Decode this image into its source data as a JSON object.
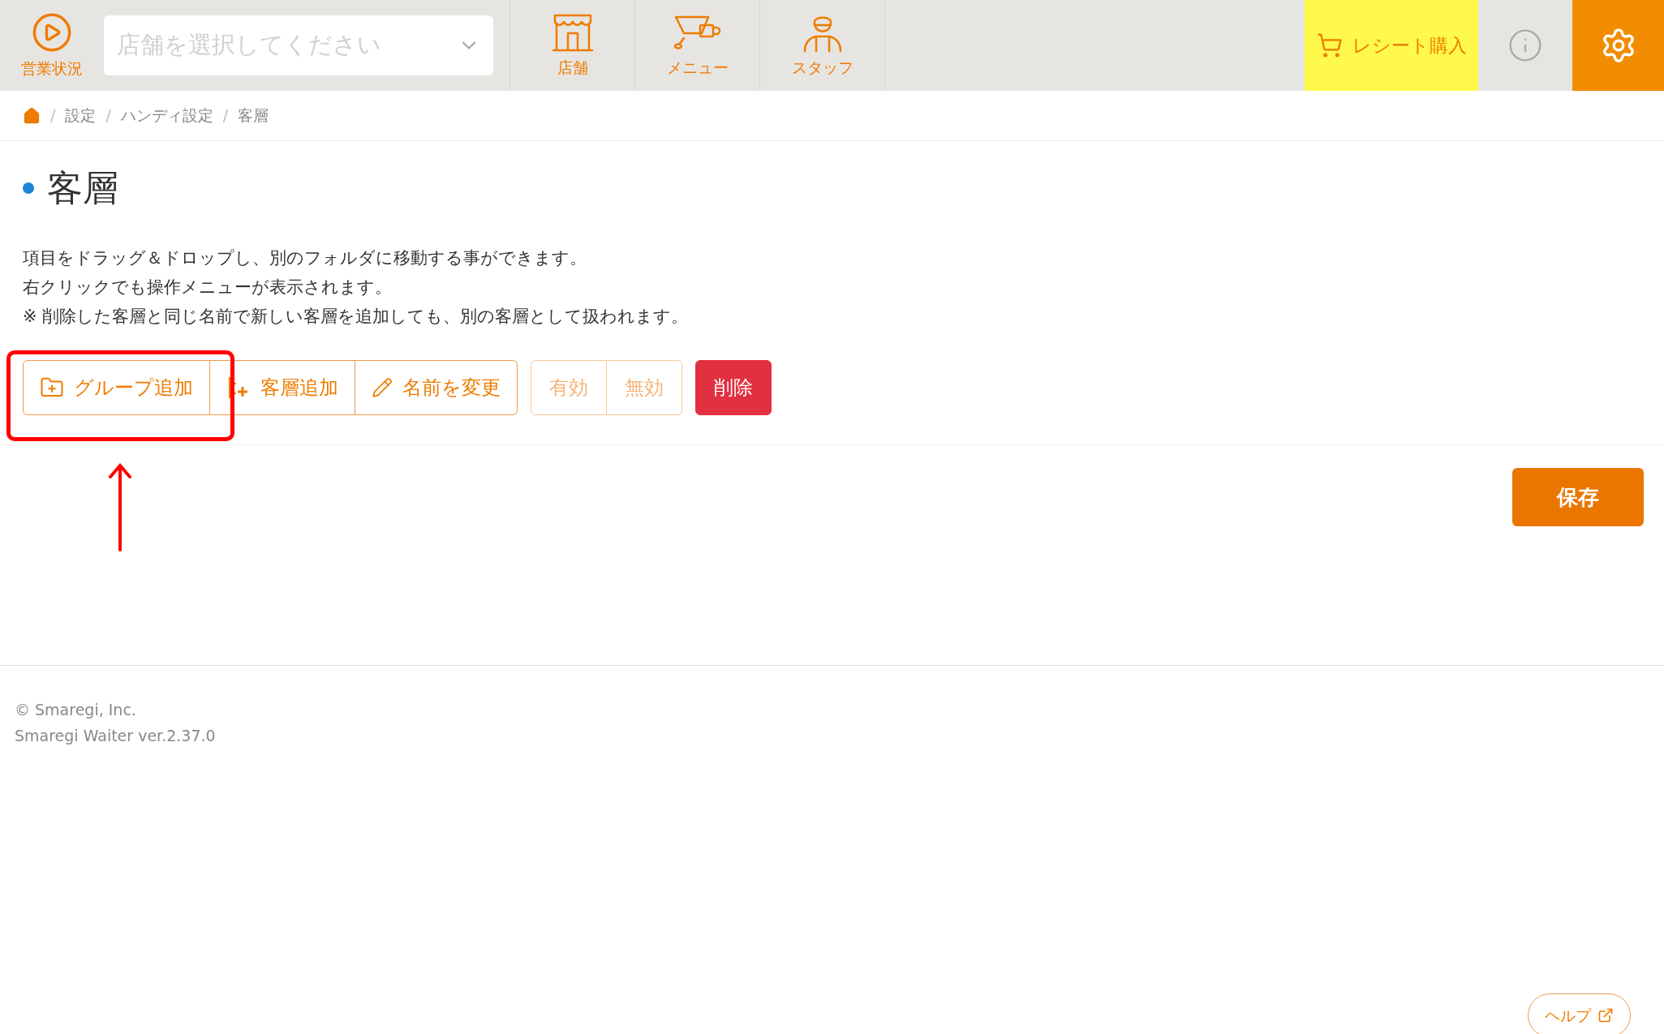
{
  "header": {
    "status": {
      "label": "営業状況"
    },
    "store_select": {
      "placeholder": "店舗を選択してください"
    },
    "nav": [
      {
        "label": "店舗",
        "kind": "store"
      },
      {
        "label": "メニュー",
        "kind": "menu"
      },
      {
        "label": "スタッフ",
        "kind": "staff"
      }
    ],
    "receipt_button": {
      "label": "レシート購入"
    }
  },
  "breadcrumb": {
    "separator": "/",
    "items": [
      "設定",
      "ハンディ設定",
      "客層"
    ]
  },
  "title": "客層",
  "description": [
    "項目をドラッグ＆ドロップし、別のフォルダに移動する事ができます。",
    "右クリックでも操作メニューが表示されます。",
    "※ 削除した客層と同じ名前で新しい客層を追加しても、別の客層として扱われます。"
  ],
  "toolbar": [
    {
      "buttons": [
        {
          "label": "グループ追加",
          "kind": "folder",
          "disabled": false
        },
        {
          "label": "客層追加",
          "kind": "item",
          "disabled": false
        },
        {
          "label": "名前を変更",
          "kind": "pencil",
          "disabled": false
        }
      ]
    },
    {
      "buttons": [
        {
          "label": "有効",
          "kind": "plain",
          "disabled": true
        },
        {
          "label": "無効",
          "kind": "plain",
          "disabled": true
        }
      ]
    },
    {
      "buttons": [
        {
          "label": "削除",
          "kind": "danger",
          "disabled": false
        }
      ]
    }
  ],
  "save_button": {
    "label": "保存"
  },
  "footer": [
    "© Smaregi, Inc.",
    "Smaregi Waiter ver.2.37.0"
  ],
  "help_link": {
    "label": "ヘルプ"
  }
}
